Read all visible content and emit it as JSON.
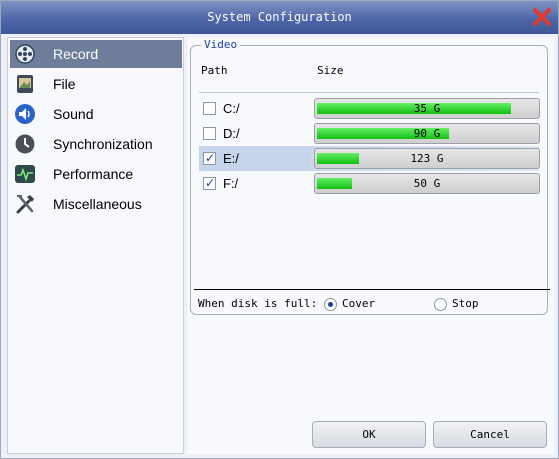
{
  "window": {
    "title": "System Configuration"
  },
  "sidebar": {
    "items": [
      {
        "label": "Record",
        "icon": "film-reel-icon",
        "selected": true
      },
      {
        "label": "File",
        "icon": "file-icon"
      },
      {
        "label": "Sound",
        "icon": "speaker-icon"
      },
      {
        "label": "Synchronization",
        "icon": "clock-icon"
      },
      {
        "label": "Performance",
        "icon": "pulse-monitor-icon"
      },
      {
        "label": "Miscellaneous",
        "icon": "tools-icon"
      }
    ]
  },
  "video": {
    "legend": "Video",
    "columns": {
      "path": "Path",
      "size": "Size"
    },
    "disks": [
      {
        "path": "C:/",
        "checked": false,
        "size": "35 G",
        "usage": 0.88,
        "highlighted": false
      },
      {
        "path": "D:/",
        "checked": false,
        "size": "90 G",
        "usage": 0.6,
        "highlighted": false
      },
      {
        "path": "E:/",
        "checked": true,
        "size": "123 G",
        "usage": 0.19,
        "highlighted": true
      },
      {
        "path": "F:/",
        "checked": true,
        "size": "50 G",
        "usage": 0.16,
        "highlighted": false
      }
    ],
    "disk_full": {
      "label": "When disk is full:",
      "options": [
        {
          "label": "Cover",
          "selected": true
        },
        {
          "label": "Stop",
          "selected": false
        }
      ]
    }
  },
  "buttons": {
    "ok": "OK",
    "cancel": "Cancel"
  },
  "colors": {
    "titlebar": "#4e66a8",
    "selected_nav": "#6e7d9a",
    "accent_text": "#1a3ea5",
    "progress_fill": "#10c010",
    "close_icon": "#e03a2e"
  }
}
